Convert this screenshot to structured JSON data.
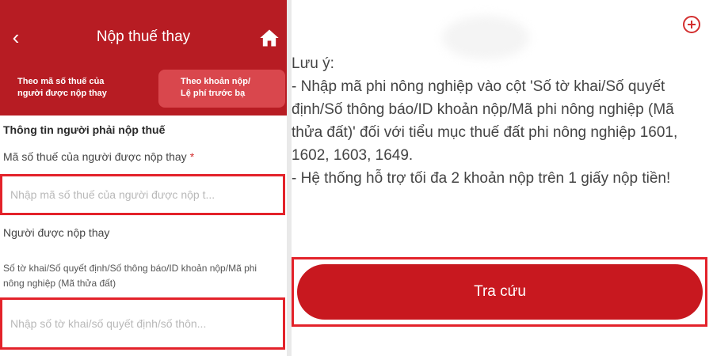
{
  "header": {
    "back_icon": "chevron-left-icon",
    "title": "Nộp thuế thay",
    "home_icon": "home-icon"
  },
  "tabs": [
    {
      "label_line1": "Theo mã số thuế của",
      "label_line2": "người được nộp thay"
    },
    {
      "label_line1": "Theo khoản nộp/",
      "label_line2": "Lệ phí trước bạ"
    }
  ],
  "form": {
    "section_title": "Thông tin người phải nộp thuế",
    "tax_id_label": "Mã số thuế của người được nộp thay",
    "required_mark": "*",
    "tax_id_placeholder": "Nhập mã số thuế của người được nộp t...",
    "payee_label": "Người được nộp thay",
    "doc_no_label": "Số tờ khai/Số quyết định/Số thông báo/ID khoản nộp/Mã phi nông nghiệp (Mã thửa đất)",
    "doc_no_placeholder": "Nhập số tờ khai/số quyết định/số thôn..."
  },
  "right_panel": {
    "add_icon": "plus-circle-icon",
    "note_title": "Lưu ý:",
    "note_line1": " - Nhập mã phi nông nghiệp vào cột 'Số tờ khai/Số quyết định/Số thông báo/ID khoản nộp/Mã phi nông nghiệp (Mã thửa đất)' đối với tiểu mục thuế đất phi nông nghiệp 1601, 1602, 1603, 1649.",
    "note_line2": " - Hệ thống hỗ trợ tối đa 2 khoản nộp trên 1 giấy nộp tiền!",
    "search_button": "Tra cứu"
  },
  "colors": {
    "brand_red": "#b71c23",
    "highlight_red": "#e3222a"
  }
}
